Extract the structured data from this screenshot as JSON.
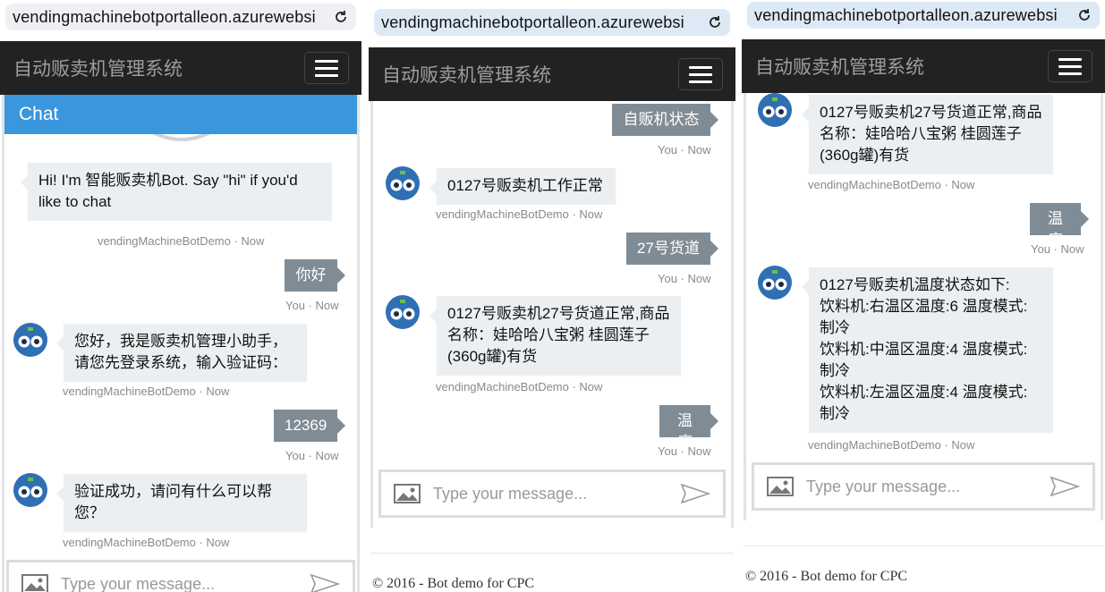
{
  "url": "vendingmachinebotportalleon.azurewebsi",
  "brand": "自动贩卖机管理系统",
  "chat_header": "Chat",
  "input_placeholder": "Type your message...",
  "footer": "© 2016 - Bot demo for CPC",
  "panel1": {
    "m1": {
      "text": "Hi! I'm 智能贩卖机Bot. Say \"hi\" if you'd like to chat",
      "meta": "vendingMachineBotDemo · Now"
    },
    "m2": {
      "text": "你好",
      "meta": "You · Now"
    },
    "m3": {
      "text": "您好，我是贩卖机管理小助手，请您先登录系统，输入验证码：",
      "meta": "vendingMachineBotDemo · Now"
    },
    "m4": {
      "text": "12369",
      "meta": "You · Now"
    },
    "m5": {
      "text": "验证成功，请问有什么可以帮您？",
      "meta": "vendingMachineBotDemo · Now"
    }
  },
  "panel2": {
    "m1": {
      "text": "自贩机状态",
      "meta": "You · Now"
    },
    "m2": {
      "text": "0127号贩卖机工作正常",
      "meta": "vendingMachineBotDemo · Now"
    },
    "m3": {
      "text": "27号货道",
      "meta": "You · Now"
    },
    "m4": {
      "text": "0127号贩卖机27号货道正常,商品名称：娃哈哈八宝粥 桂圆莲子(360g罐)有货",
      "meta": "vendingMachineBotDemo · Now"
    },
    "m5": {
      "text": "温度",
      "meta": "You · Now"
    }
  },
  "panel3": {
    "m1": {
      "text": "0127号贩卖机27号货道正常,商品名称：娃哈哈八宝粥 桂圆莲子(360g罐)有货",
      "meta": "vendingMachineBotDemo · Now"
    },
    "m2": {
      "text": "温度",
      "meta": "You · Now"
    },
    "m3": {
      "lines": [
        "0127号贩卖机温度状态如下:",
        "饮料机:右温区温度:6 温度模式:制冷",
        "饮料机:中温区温度:4 温度模式:制冷",
        "饮料机:左温区温度:4 温度模式:制冷"
      ],
      "meta": "vendingMachineBotDemo · Now"
    }
  }
}
